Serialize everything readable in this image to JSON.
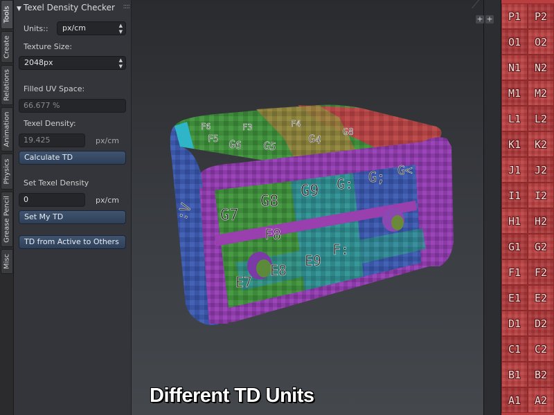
{
  "tabs": [
    {
      "label": "Tools"
    },
    {
      "label": "Create"
    },
    {
      "label": "Relations"
    },
    {
      "label": "Animation"
    },
    {
      "label": "Physics"
    },
    {
      "label": "Grease Pencil"
    },
    {
      "label": "Misc"
    }
  ],
  "panel": {
    "header_title": "Texel Density Checker",
    "units_label": "Units::",
    "units_value": "px/cm",
    "texture_size_label": "Texture Size:",
    "texture_size_value": "2048px",
    "filled_uv_label": "Filled UV Space:",
    "filled_uv_value": "66.677 %",
    "texel_density_label": "Texel Density:",
    "texel_density_value": "19.425",
    "texel_density_unit": "px/cm",
    "calculate_button": "Calculate TD",
    "set_texel_label": "Set Texel Density",
    "set_texel_value": "0",
    "set_texel_unit": "px/cm",
    "set_my_td_button": "Set My TD",
    "td_active_button": "TD from Active to Others"
  },
  "viewport": {
    "caption": "Different TD Units",
    "face_labels_top": [
      "G6",
      "G5",
      "G4",
      "F3",
      "F4",
      "F6",
      "F5",
      "G8"
    ],
    "face_labels_front": [
      "G7",
      "G8",
      "G9",
      "G:",
      "G;",
      "G<",
      "F8",
      "E8",
      "E9",
      "F:",
      "E7"
    ],
    "side_label": ":V"
  },
  "uv_editor": {
    "plus_left": "+",
    "plus_right": "+",
    "rows": [
      [
        "P1",
        "P2"
      ],
      [
        "O1",
        "O2"
      ],
      [
        "N1",
        "N2"
      ],
      [
        "M1",
        "M2"
      ],
      [
        "L1",
        "L2"
      ],
      [
        "K1",
        "K2"
      ],
      [
        "J1",
        "J2"
      ],
      [
        "I1",
        "I2"
      ],
      [
        "H1",
        "H2"
      ],
      [
        "G1",
        "G2"
      ],
      [
        "F1",
        "F2"
      ],
      [
        "E1",
        "E2"
      ],
      [
        "D1",
        "D2"
      ],
      [
        "C1",
        "C2"
      ],
      [
        "B1",
        "B2"
      ],
      [
        "A1",
        "A2"
      ]
    ]
  },
  "colors": {
    "checker_green": "#3f8a3c",
    "checker_teal": "#2f8a8c",
    "checker_blue": "#3a55a8",
    "checker_purple": "#8a3ba8",
    "checker_red": "#b83e3f",
    "checker_olive": "#8c7a3a",
    "accent_button": "#3f5470"
  }
}
